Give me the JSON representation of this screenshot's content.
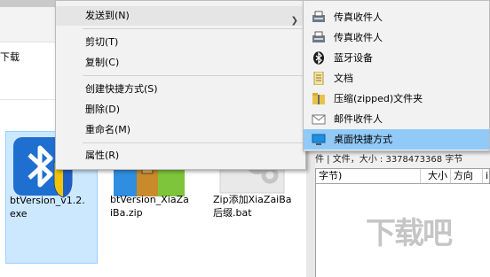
{
  "explorer": {
    "left_text": "下载",
    "files": [
      {
        "name": "btVersion_v1.2.\nexe",
        "selected": true,
        "icon": "bluetooth-installer-icon"
      },
      {
        "name": "btVersion_XiaZa\niBa.zip",
        "selected": false,
        "icon": "zip-archive-icon"
      },
      {
        "name": "Zip添加XiaZaiBa\n后缀.bat",
        "selected": false,
        "icon": "gear-batch-icon"
      }
    ]
  },
  "context_menu": {
    "send_to": "发送到(N)",
    "cut": "剪切(T)",
    "copy": "复制(C)",
    "create_shortcut": "创建快捷方式(S)",
    "delete": "删除(D)",
    "rename": "重命名(M)",
    "properties": "属性(R)"
  },
  "submenu": {
    "items": [
      {
        "label": "传真收件人",
        "icon": "fax-icon"
      },
      {
        "label": "传真收件人",
        "icon": "fax-icon"
      },
      {
        "label": "蓝牙设备",
        "icon": "bluetooth-icon"
      },
      {
        "label": "文档",
        "icon": "document-icon"
      },
      {
        "label": "压缩(zipped)文件夹",
        "icon": "zip-folder-icon"
      },
      {
        "label": "邮件收件人",
        "icon": "mail-icon"
      },
      {
        "label": "桌面快捷方式",
        "icon": "desktop-icon",
        "highlighted": true
      }
    ]
  },
  "background_window": {
    "info": "件 | 文件，大小 : 3378473368 字节",
    "col_size_unit": "字节)",
    "col_size": "大小",
    "col_direction": "方向",
    "col_more": "i"
  },
  "watermark": "下载吧",
  "colors": {
    "selection": "#cce8ff",
    "submenu_highlight": "#91c9f7",
    "menu_bg": "#f2f2f2"
  }
}
